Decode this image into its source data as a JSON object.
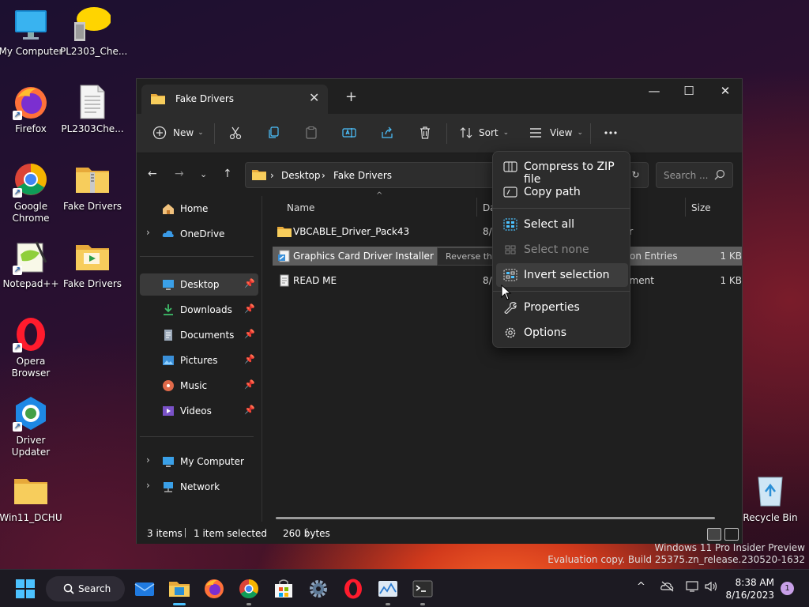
{
  "desktop": {
    "icons": [
      {
        "label": "My Computer"
      },
      {
        "label": "PL2303_Che..."
      },
      {
        "label": "Firefox"
      },
      {
        "label": "PL2303Che..."
      },
      {
        "label": "Google Chrome"
      },
      {
        "label": "Fake Drivers"
      },
      {
        "label": "Notepad++"
      },
      {
        "label": "Fake Drivers"
      },
      {
        "label": "Opera Browser"
      },
      {
        "label": "Driver Updater"
      },
      {
        "label": "Win11_DCHU"
      },
      {
        "label": "Recycle Bin"
      }
    ]
  },
  "explorer": {
    "tab_title": "Fake Drivers",
    "toolbar": {
      "new_label": "New",
      "sort_label": "Sort",
      "view_label": "View"
    },
    "address": {
      "crumbs": [
        "Desktop",
        "Fake Drivers"
      ]
    },
    "search_placeholder": "Search ...",
    "sidebar": {
      "items": [
        {
          "label": "Home"
        },
        {
          "label": "OneDrive"
        },
        {
          "label": "Desktop"
        },
        {
          "label": "Downloads"
        },
        {
          "label": "Documents"
        },
        {
          "label": "Pictures"
        },
        {
          "label": "Music"
        },
        {
          "label": "Videos"
        },
        {
          "label": "My Computer"
        },
        {
          "label": "Network"
        }
      ]
    },
    "columns": {
      "name": "Name",
      "date": "Da",
      "size": "Size"
    },
    "files": [
      {
        "name": "VBCABLE_Driver_Pack43",
        "date": "8/1",
        "type": "er",
        "size": ""
      },
      {
        "name": "Graphics Card Driver Installer",
        "date": "",
        "type": "tion Entries",
        "size": "1 KB"
      },
      {
        "name": "READ ME",
        "date": "8/1",
        "type": "ument",
        "size": "1 KB"
      }
    ],
    "tooltip": "Reverse the current selection.",
    "status": {
      "items": "3 items",
      "selected": "1 item selected",
      "bytes": "260 bytes"
    }
  },
  "context_menu": {
    "items": [
      {
        "label": "Compress to ZIP file"
      },
      {
        "label": "Copy path"
      },
      {
        "label": "Select all"
      },
      {
        "label": "Select none"
      },
      {
        "label": "Invert selection"
      },
      {
        "label": "Properties"
      },
      {
        "label": "Options"
      }
    ]
  },
  "watermark": {
    "line1": "Windows 11 Pro Insider Preview",
    "line2": "Evaluation copy. Build 25375.zn_release.230520-1632"
  },
  "taskbar": {
    "search_label": "Search",
    "time": "8:38 AM",
    "date": "8/16/2023",
    "notification_count": "1"
  },
  "colors": {
    "accent": "#4cc2ff",
    "folder": "#f5c84c",
    "selection": "#5e5e5e"
  }
}
